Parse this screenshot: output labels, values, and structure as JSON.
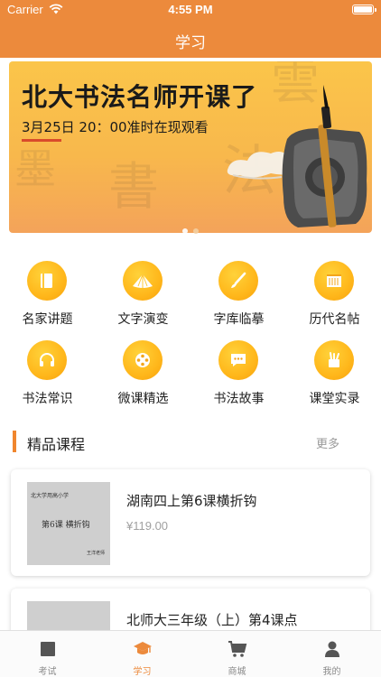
{
  "status_bar": {
    "carrier": "Carrier",
    "time": "4:55 PM"
  },
  "nav": {
    "title": "学习"
  },
  "banner": {
    "headline": "北大书法名师开课了",
    "subline": "3月25日 20：00准时在现观看",
    "page_indicator": {
      "count": 2,
      "active": 1
    }
  },
  "categories": [
    {
      "label": "名家讲题",
      "icon": "book-icon"
    },
    {
      "label": "文字演变",
      "icon": "fan-icon"
    },
    {
      "label": "字库临摹",
      "icon": "brush-icon"
    },
    {
      "label": "历代名帖",
      "icon": "scroll-icon"
    },
    {
      "label": "书法常识",
      "icon": "headset-icon"
    },
    {
      "label": "微课精选",
      "icon": "film-reel-icon"
    },
    {
      "label": "书法故事",
      "icon": "chat-bubble-icon"
    },
    {
      "label": "课堂实录",
      "icon": "pen-holder-icon"
    }
  ],
  "section": {
    "title": "精品课程",
    "more": "更多"
  },
  "courses": [
    {
      "title": "湖南四上第6课横折钩",
      "price": "¥119.00",
      "thumb_school": "北大学用高小学",
      "thumb_lesson": "第6课 横折钩",
      "thumb_teacher": "王洋老师"
    },
    {
      "title": "北师大三年级（上）第4课点",
      "price": ""
    }
  ],
  "tabbar": [
    {
      "label": "考试",
      "icon": "exam-icon",
      "active": false
    },
    {
      "label": "学习",
      "icon": "graduation-cap-icon",
      "active": true
    },
    {
      "label": "商城",
      "icon": "cart-icon",
      "active": false
    },
    {
      "label": "我的",
      "icon": "user-icon",
      "active": false
    }
  ],
  "colors": {
    "brand": "#ec8a3c",
    "icon_fill": "#ffb71b",
    "accent_bar": "#f0862e"
  }
}
